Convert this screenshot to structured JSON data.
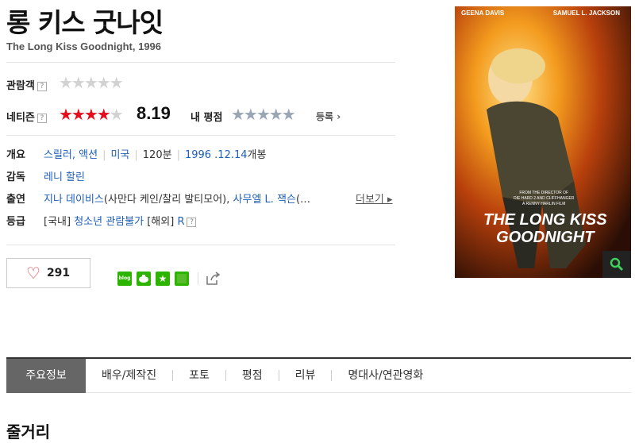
{
  "movie": {
    "title": "롱 키스 굿나잇",
    "subtitle": "The Long Kiss Goodnight, 1996"
  },
  "ratings": {
    "audience_label": "관람객",
    "audience_stars": "★★★★★",
    "netizen_label": "네티즌",
    "netizen_score": "8.19",
    "netizen_stars_filled": "★★★★",
    "netizen_stars_empty": "★",
    "my_rating_label": "내 평점",
    "my_rating_stars": "★★★★★",
    "register_label": "등록 ›",
    "help": "?"
  },
  "info": {
    "overview_label": "개요",
    "genre": "스릴러, 액션",
    "country": "미국",
    "runtime": "120분",
    "release_date": "1996 .12.14",
    "release_suffix": "개봉",
    "director_label": "감독",
    "director": "레니 할린",
    "cast_label": "출연",
    "cast_1": "지나 데이비스",
    "cast_1_role": "(사만다 케인/찰리 발티모어),",
    "cast_2": "사무엘 L. 잭슨",
    "cast_2_role": "(…",
    "more_label": "더보기 ▸",
    "grade_label": "등급",
    "grade_domestic_prefix": "[국내]",
    "grade_domestic": "청소년 관람불가",
    "grade_foreign_prefix": "[해외]",
    "grade_foreign": "R"
  },
  "actions": {
    "like_count": "291",
    "blog_label": "blog"
  },
  "tabs": [
    {
      "label": "주요정보"
    },
    {
      "label": "배우/제작진"
    },
    {
      "label": "포토"
    },
    {
      "label": "평점"
    },
    {
      "label": "리뷰"
    },
    {
      "label": "명대사/연관영화"
    }
  ],
  "section_title": "줄거리",
  "poster": {
    "actor_left": "GEENA DAVIS",
    "actor_right": "SAMUEL L. JACKSON",
    "tagline_1": "FROM THE DIRECTOR OF",
    "tagline_2": "DIE HARD 2 AND CLIFFHANGER",
    "tagline_3": "A RENNY HARLIN FILM",
    "title_line_1": "THE LONG KISS",
    "title_line_2": "GOODNIGHT"
  },
  "colors": {
    "link": "#1f5fb7",
    "star_red": "#e50d1c",
    "tab_active": "#666666"
  }
}
